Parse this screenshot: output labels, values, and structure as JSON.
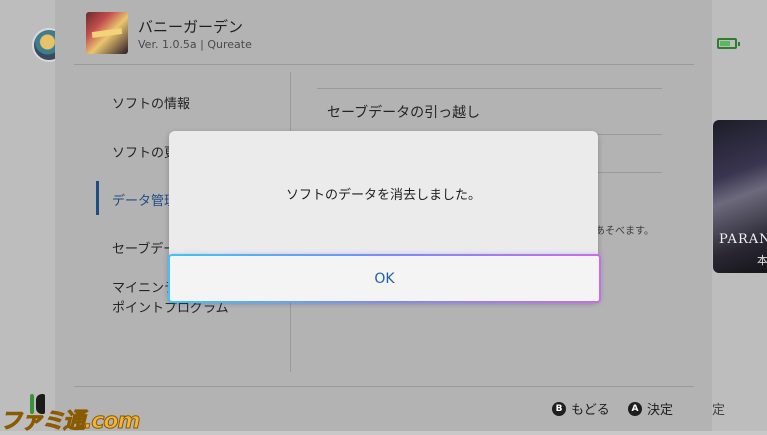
{
  "game": {
    "title": "バニーガーデン",
    "subtitle": "Ver. 1.0.5a  |  Qureate"
  },
  "sidebar": {
    "items": [
      {
        "label": "ソフトの情報"
      },
      {
        "label": "ソフトの更"
      },
      {
        "label": "データ管理"
      },
      {
        "label": "セーブデー"
      },
      {
        "label": "マイニンテ"
      },
      {
        "label": "ポイントプログラム"
      }
    ]
  },
  "content": {
    "item1": "セーブデータの引っ越し",
    "note": "あそべます。"
  },
  "background": {
    "tile_title": "PARAN",
    "tile_sub": "本",
    "right_label": "定"
  },
  "footer": {
    "back_key": "B",
    "back_label": "もどる",
    "confirm_key": "A",
    "confirm_label": "決定"
  },
  "dialog": {
    "message": "ソフトのデータを消去しました。",
    "ok_label": "OK"
  },
  "watermark": "ファミ通.com",
  "status": {
    "battery_level": 0.7
  },
  "colors": {
    "accent": "#1f4d80",
    "ok_text": "#1f5fa8",
    "battery": "#2e7d2e"
  }
}
